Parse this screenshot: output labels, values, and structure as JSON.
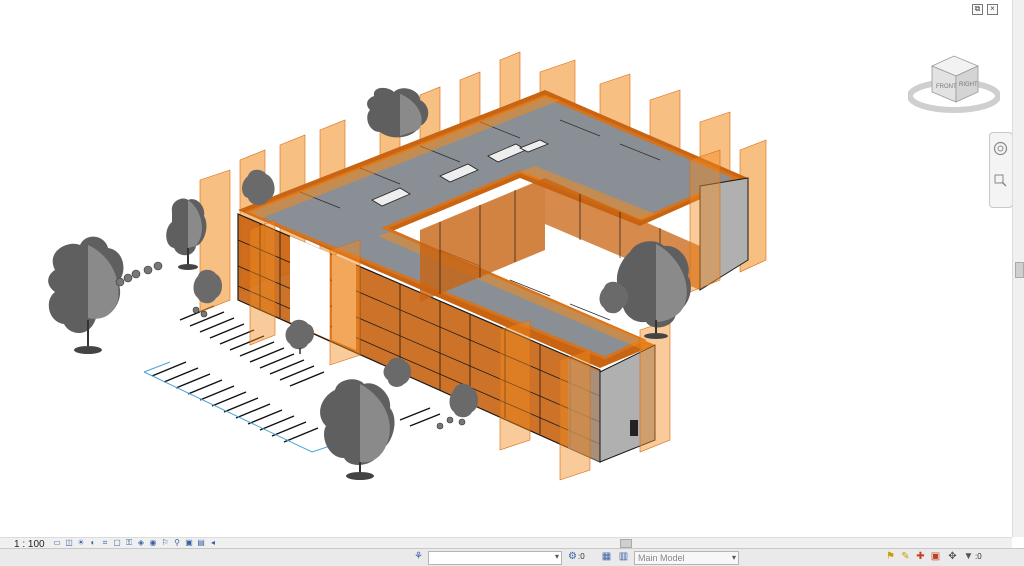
{
  "view": {
    "scale": "1 : 100",
    "viewcube": {
      "front_label": "FRONT",
      "right_label": "RIGHT"
    }
  },
  "window_controls": {
    "restore": "⧉",
    "close": "×"
  },
  "status": {
    "workset_value": "",
    "sync_count": ":0",
    "model": "Main Model",
    "filter_count": ":0"
  },
  "colors": {
    "section_plane": "#f28a1e",
    "frame": "#c86412",
    "roof": "#8a8f96",
    "tree": "#6a6a6a",
    "parking_line": "#4aa3d8"
  },
  "icons": {
    "view_control_bar": [
      "sheet-icon",
      "cube-icon",
      "sun-path-icon",
      "shadows-icon",
      "crop-icon",
      "show-crop-icon",
      "unlock-3d-icon",
      "temp-hide-icon",
      "reveal-hidden-icon",
      "worksharing-icon",
      "analytical-icon",
      "highlight-icon",
      "reveal-constraints-icon",
      "arrow-icon"
    ],
    "status_right": [
      "link-select-icon",
      "underlay-select-icon",
      "pinned-select-icon",
      "face-select-icon",
      "drag-select-icon",
      "filter-icon"
    ]
  }
}
